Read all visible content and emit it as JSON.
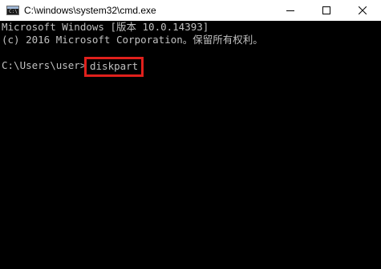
{
  "window": {
    "title": "C:\\windows\\system32\\cmd.exe",
    "minimize_icon": "minimize-icon",
    "maximize_icon": "maximize-icon",
    "close_icon": "close-icon"
  },
  "console": {
    "lines": [
      "Microsoft Windows [版本 10.0.14393]",
      "(c) 2016 Microsoft Corporation。保留所有权利。"
    ],
    "prompt": "C:\\Users\\user>",
    "command": "diskpart"
  },
  "colors": {
    "console_bg": "#000000",
    "console_text": "#c0c0c0",
    "titlebar_bg": "#ffffff",
    "highlight_box": "#e0201c"
  }
}
